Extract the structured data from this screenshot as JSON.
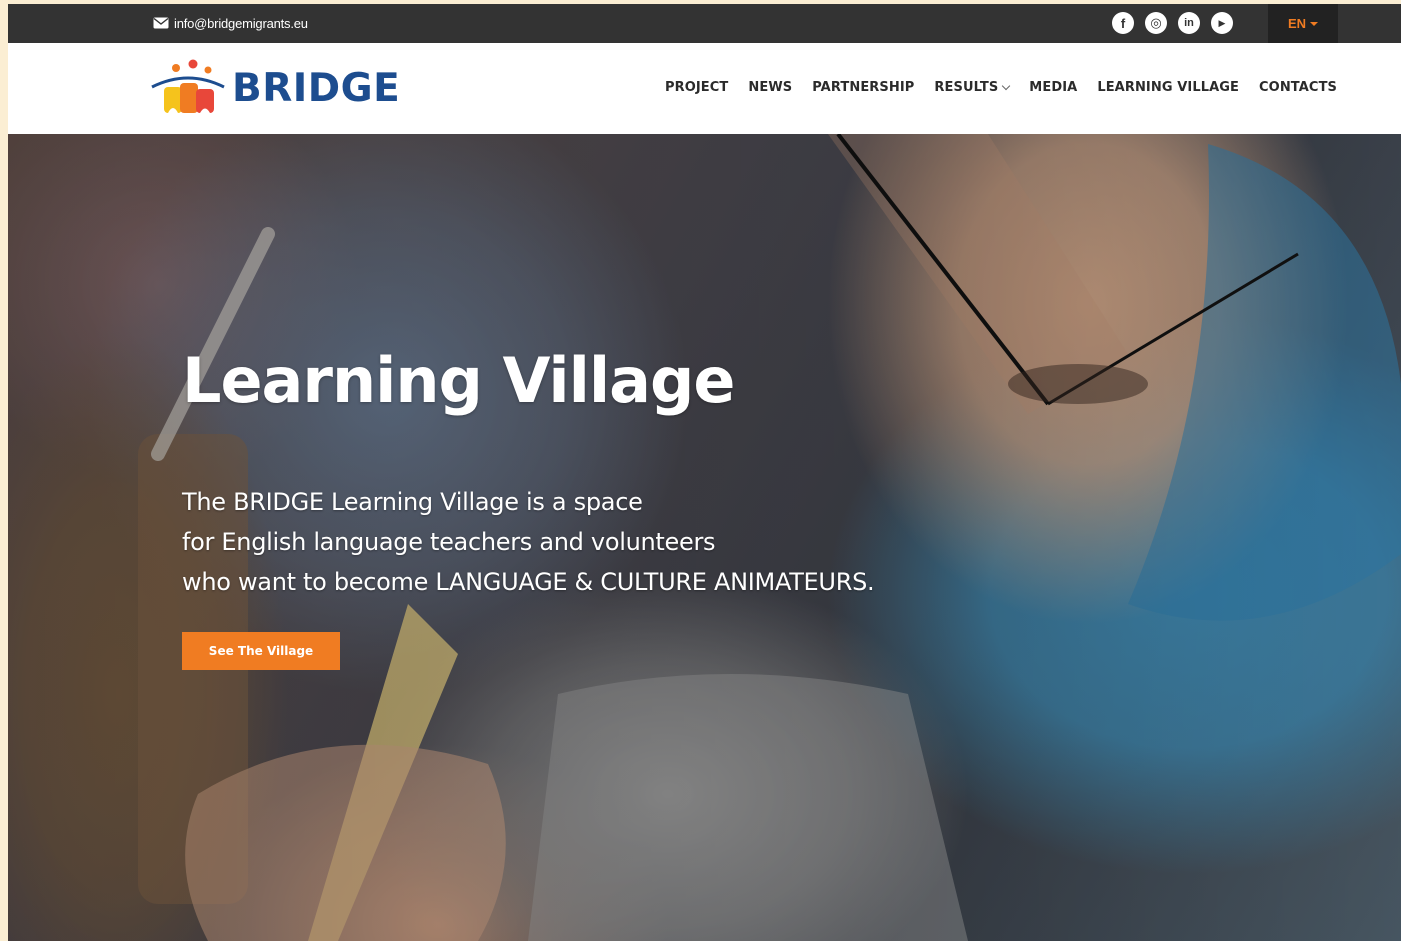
{
  "topbar": {
    "email": "info@bridgemigrants.eu",
    "email_icon": "envelope-icon",
    "socials": [
      {
        "name": "facebook-icon",
        "glyph": "f"
      },
      {
        "name": "instagram-icon",
        "glyph": "◎"
      },
      {
        "name": "linkedin-icon",
        "glyph": "in"
      },
      {
        "name": "youtube-icon",
        "glyph": "▶"
      }
    ],
    "language": "EN"
  },
  "header": {
    "logo_text": "BRIDGE",
    "nav": [
      {
        "label": "PROJECT"
      },
      {
        "label": "NEWS"
      },
      {
        "label": "PARTNERSHIP"
      },
      {
        "label": "RESULTS",
        "has_dropdown": true
      },
      {
        "label": "MEDIA"
      },
      {
        "label": "LEARNING VILLAGE"
      },
      {
        "label": "CONTACTS"
      }
    ]
  },
  "hero": {
    "title": "Learning Village",
    "lines": [
      "The BRIDGE Learning Village is a space",
      "for English language teachers and volunteers",
      "who want to become LANGUAGE & CULTURE ANIMATEURS."
    ],
    "cta_label": "See The Village"
  },
  "colors": {
    "accent": "#f07c22",
    "brand_blue": "#1d4d8f",
    "topbar_bg": "#333333"
  }
}
